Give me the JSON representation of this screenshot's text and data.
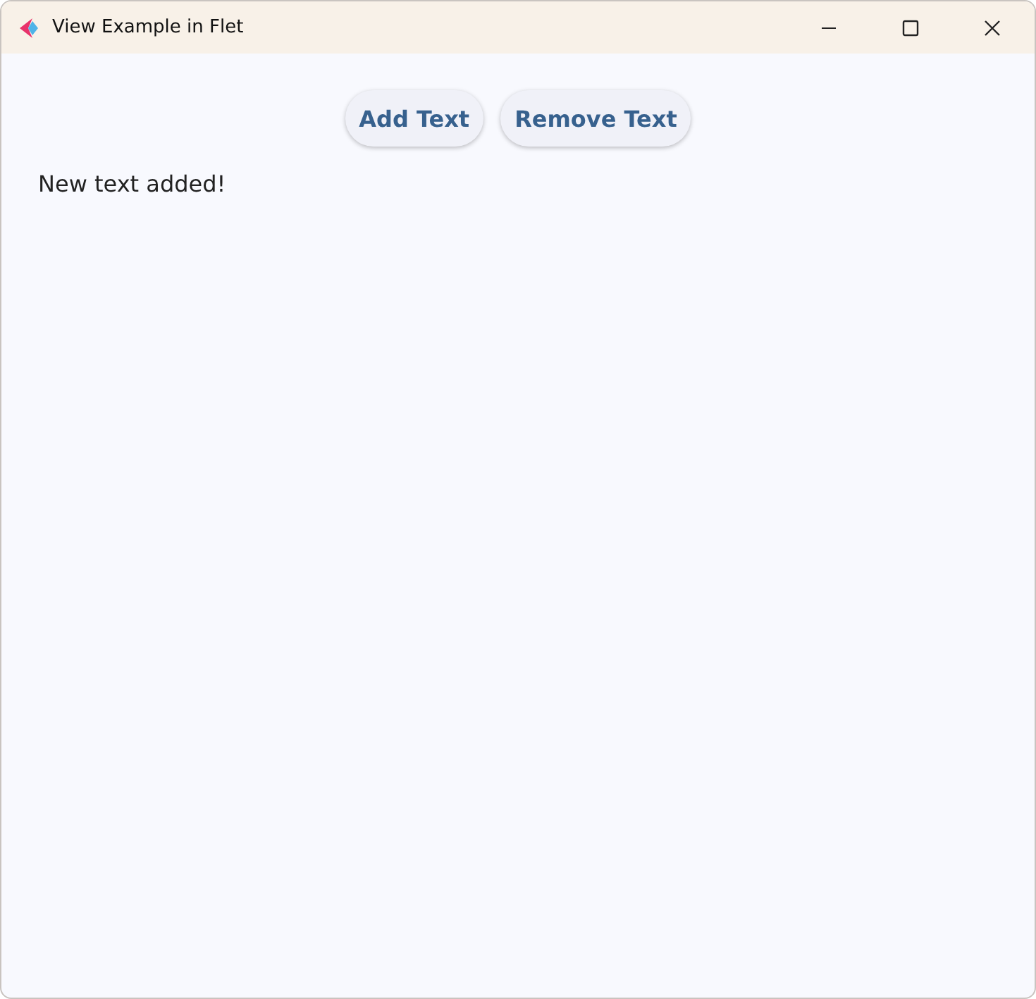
{
  "window": {
    "title": "View Example in Flet"
  },
  "buttons": [
    "Add Text",
    "Remove Text"
  ],
  "texts": [
    "New text added!"
  ]
}
